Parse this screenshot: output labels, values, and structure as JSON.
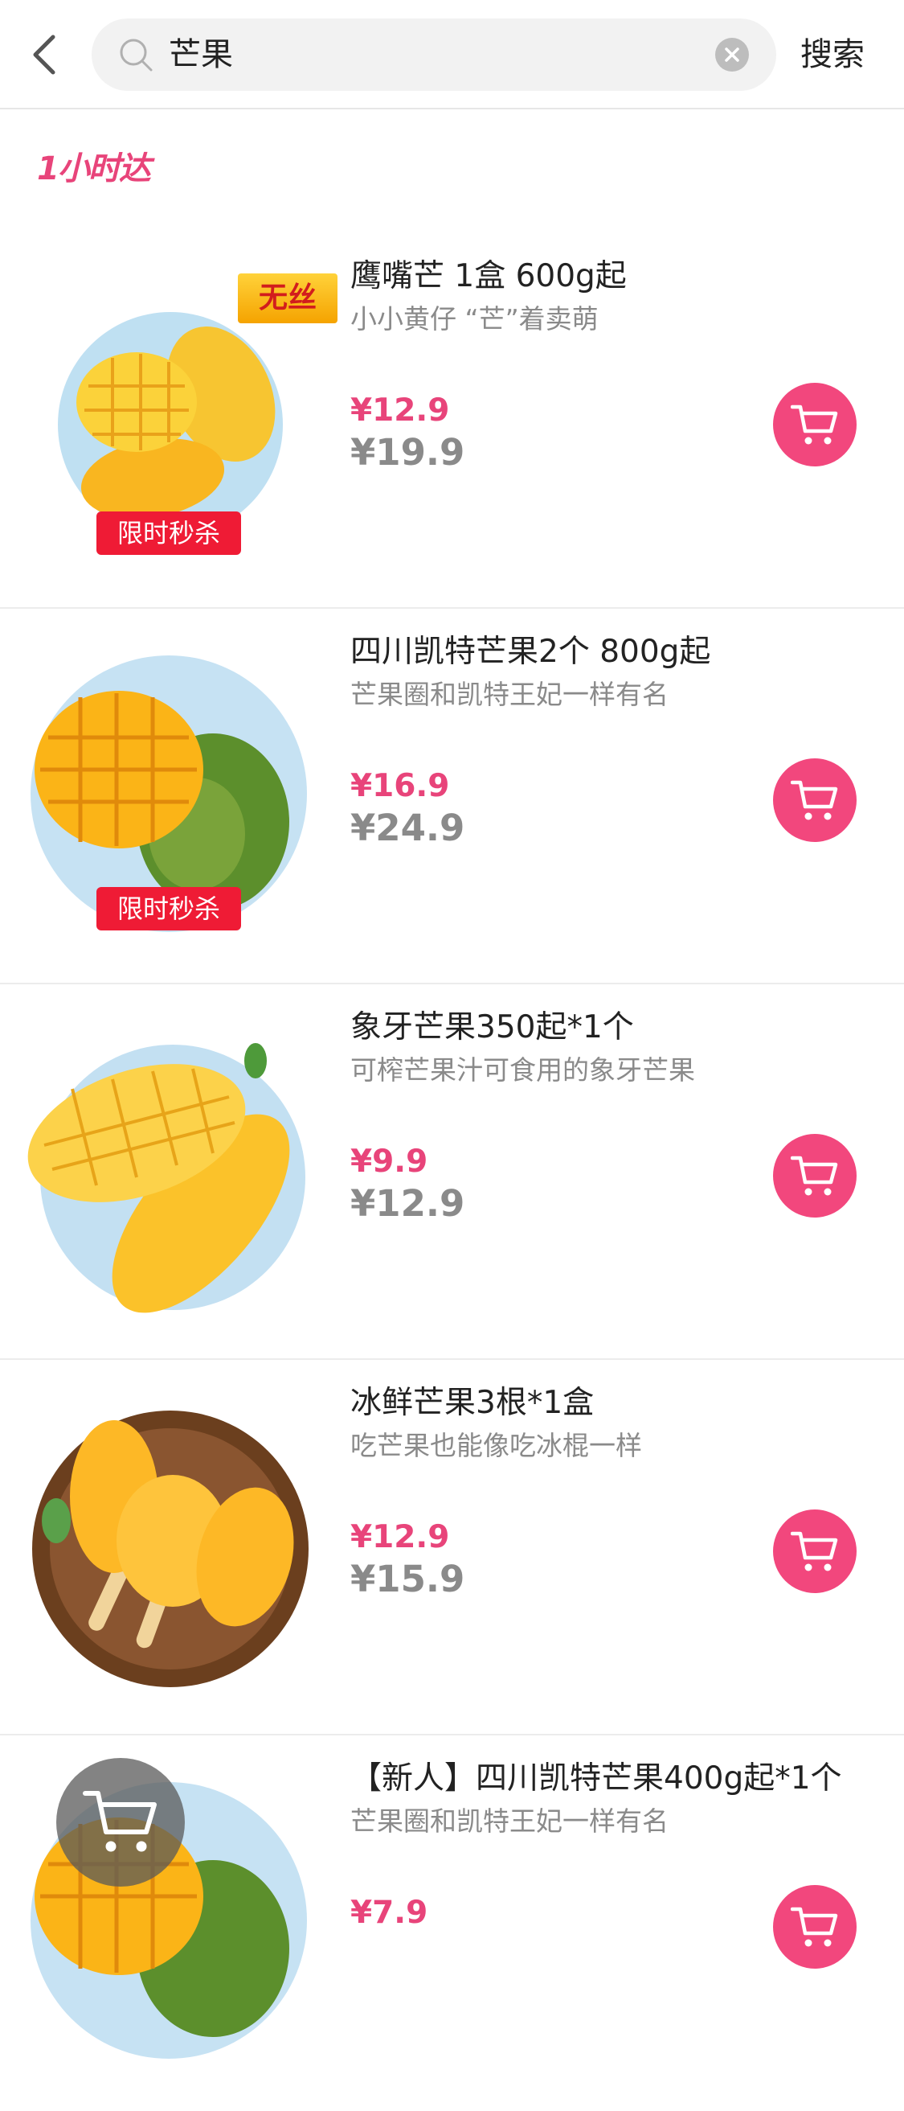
{
  "header": {
    "search_value": "芒果",
    "search_button": "搜索"
  },
  "logo_text": "1小时达",
  "products": [
    {
      "name": "鹰嘴芒 1盒 600g起",
      "desc": "小小黄仔 “芒”着卖萌",
      "price": "¥12.9",
      "orig_price": "¥19.9",
      "badge_top": "无丝",
      "badge_flash": "限时秒杀"
    },
    {
      "name": "四川凯特芒果2个 800g起",
      "desc": "芒果圈和凯特王妃一样有名",
      "price": "¥16.9",
      "orig_price": "¥24.9",
      "badge_top": "",
      "badge_flash": "限时秒杀"
    },
    {
      "name": "象牙芒果350起*1个",
      "desc": "可榨芒果汁可食用的象牙芒果",
      "price": "¥9.9",
      "orig_price": "¥12.9",
      "badge_top": "",
      "badge_flash": ""
    },
    {
      "name": "冰鲜芒果3根*1盒",
      "desc": "吃芒果也能像吃冰棍一样",
      "price": "¥12.9",
      "orig_price": "¥15.9",
      "badge_top": "",
      "badge_flash": ""
    },
    {
      "name": "【新人】四川凯特芒果400g起*1个",
      "desc": "芒果圈和凯特王妃一样有名",
      "price": "¥7.9",
      "orig_price": "",
      "badge_top": "",
      "badge_flash": ""
    }
  ],
  "colors": {
    "accent": "#f2477d",
    "price": "#e8447a",
    "flash_badge": "#ef1b35"
  },
  "icons": {
    "back": "chevron-left-icon",
    "search": "search-icon",
    "clear": "clear-icon",
    "cart": "cart-icon"
  }
}
